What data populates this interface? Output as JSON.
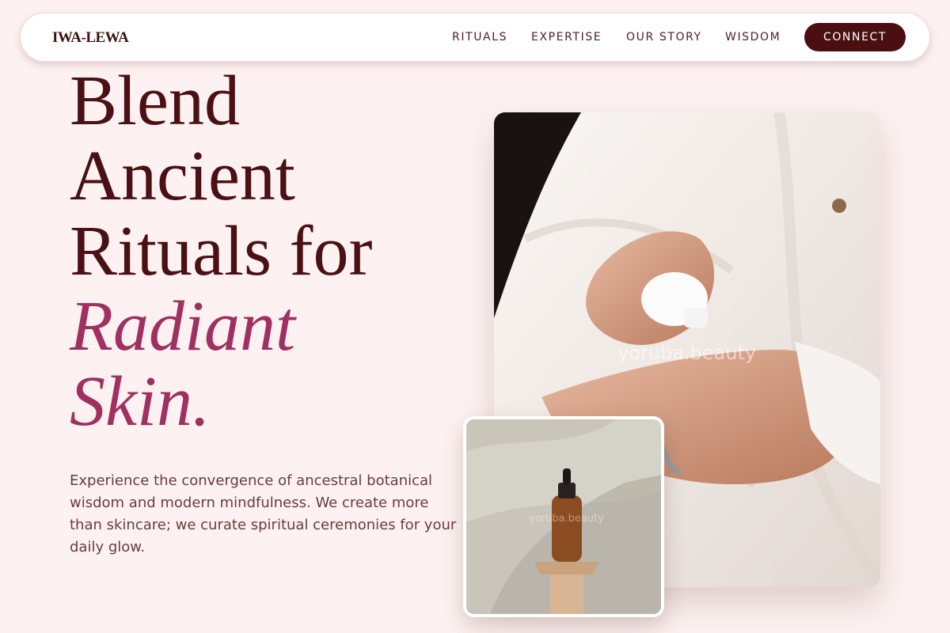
{
  "brand": {
    "name": "IWA-LEWA"
  },
  "nav": {
    "links": [
      "RITUALS",
      "EXPERTISE",
      "OUR STORY",
      "WISDOM"
    ],
    "cta_label": "CONNECT"
  },
  "hero": {
    "headline_line1": "Blend",
    "headline_line2": "Ancient",
    "headline_line3": "Rituals for",
    "headline_accent1": "Radiant",
    "headline_accent2": "Skin.",
    "description": "Experience the convergence of ancestral botanical wisdom and modern mindfulness. We create more than skincare; we curate spiritual ceremonies for your daily glow.",
    "main_image_watermark": "yoruba.beauty",
    "small_image_watermark": "yoruba.beauty"
  },
  "colors": {
    "background": "#fdf2f1",
    "primary": "#4a1013",
    "accent": "#a03060",
    "cta": "#4a0f11"
  }
}
